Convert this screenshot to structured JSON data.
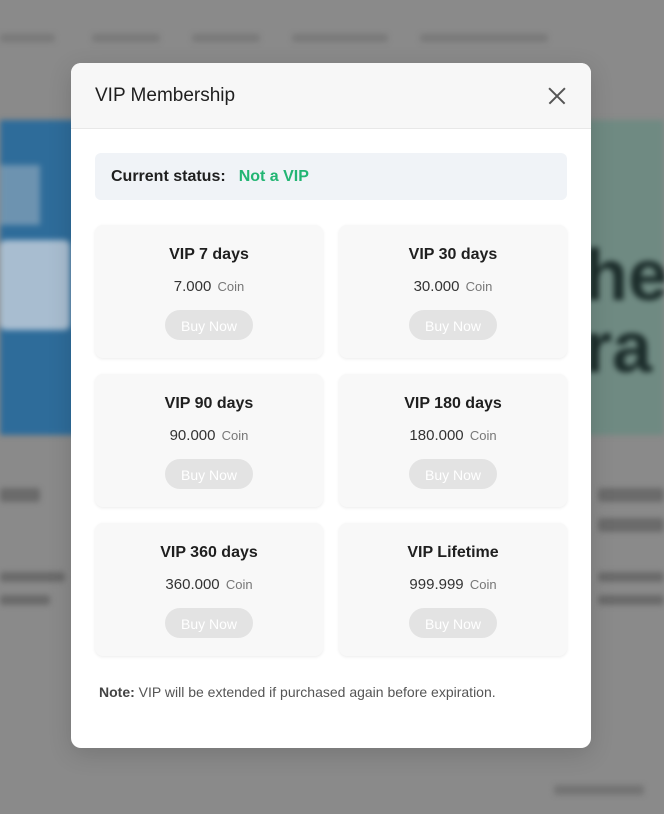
{
  "modal": {
    "title": "VIP Membership",
    "status_label": "Current status:",
    "status_value": "Not a VIP",
    "plans": [
      {
        "name": "VIP 7 days",
        "price": "7.000",
        "unit": "Coin",
        "button": "Buy Now"
      },
      {
        "name": "VIP 30 days",
        "price": "30.000",
        "unit": "Coin",
        "button": "Buy Now"
      },
      {
        "name": "VIP 90 days",
        "price": "90.000",
        "unit": "Coin",
        "button": "Buy Now"
      },
      {
        "name": "VIP 180 days",
        "price": "180.000",
        "unit": "Coin",
        "button": "Buy Now"
      },
      {
        "name": "VIP 360 days",
        "price": "360.000",
        "unit": "Coin",
        "button": "Buy Now"
      },
      {
        "name": "VIP Lifetime",
        "price": "999.999",
        "unit": "Coin",
        "button": "Buy Now"
      }
    ],
    "note_label": "Note:",
    "note_text": "VIP will be extended if purchased again before expiration.",
    "close_icon": "close-icon"
  },
  "colors": {
    "status_green": "#22b573",
    "overlay": "#8a8a8a",
    "button_disabled": "#e3e3e3"
  }
}
